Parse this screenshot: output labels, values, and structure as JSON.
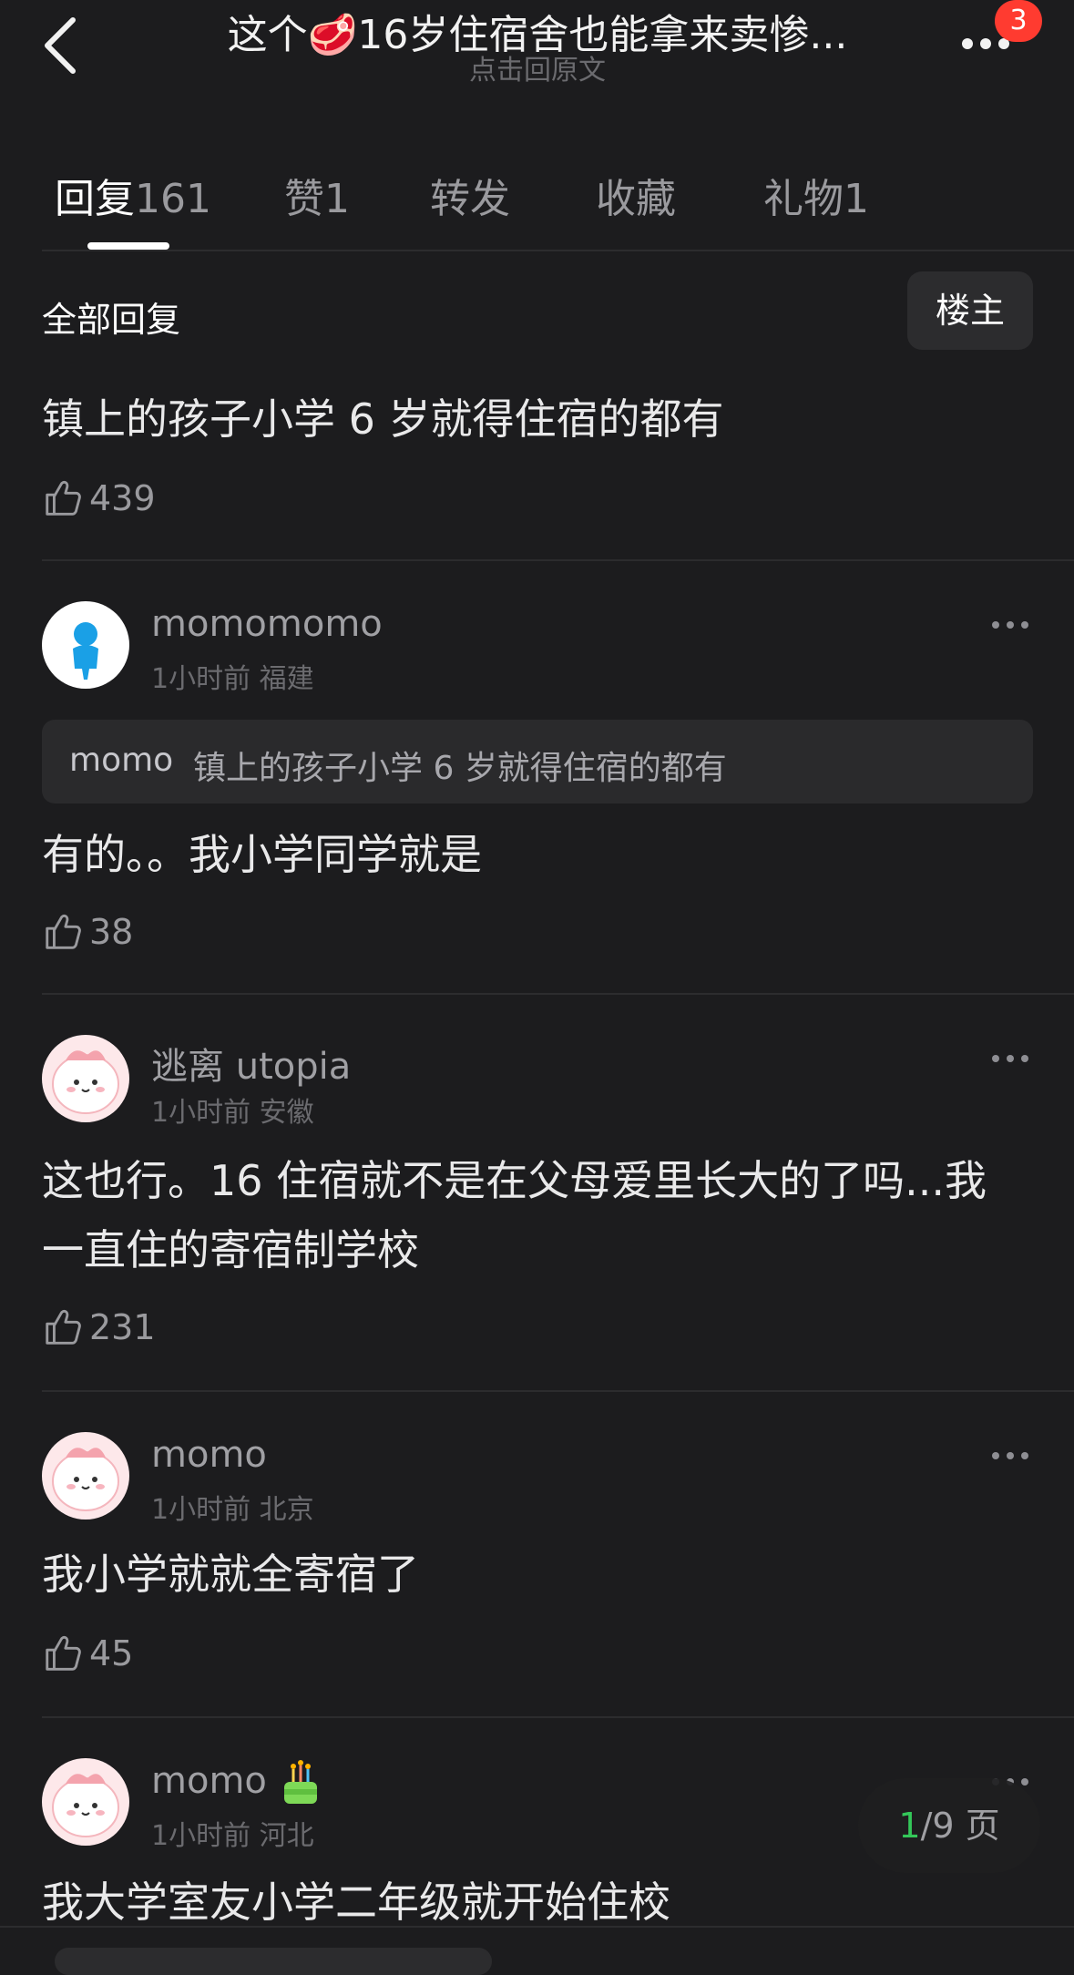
{
  "header": {
    "title": "这个🥩16岁住宿舍也能拿来卖惨...",
    "subtitle": "点击回原文",
    "badge_count": "3"
  },
  "tabs": [
    {
      "label": "回复",
      "count": "161",
      "active": true
    },
    {
      "label": "赞",
      "count": "1",
      "active": false
    },
    {
      "label": "转发",
      "count": "",
      "active": false
    },
    {
      "label": "收藏",
      "count": "",
      "active": false
    },
    {
      "label": "礼物",
      "count": "1",
      "active": false
    }
  ],
  "section": {
    "title": "全部回复",
    "owner_button": "楼主"
  },
  "op": {
    "text": "镇上的孩子小学 6 岁就得住宿的都有",
    "likes": "439"
  },
  "comments": [
    {
      "username": "momomomo",
      "time": "1小时前",
      "location": "福建",
      "quote_name": "momo",
      "quote_text": "镇上的孩子小学 6 岁就得住宿的都有",
      "text": "有的。。我小学同学就是",
      "likes": "38"
    },
    {
      "username": "逃离 utopia",
      "time": "1小时前",
      "location": "安徽",
      "text_line1": "这也行。16 住宿就不是在父母爱里长大的了吗...我",
      "text_line2": "一直住的寄宿制学校",
      "likes": "231"
    },
    {
      "username": "momo",
      "time": "1小时前",
      "location": "北京",
      "text": "我小学就就全寄宿了",
      "likes": "45"
    },
    {
      "username": "momo",
      "time": "1小时前",
      "location": "河北",
      "text": "我大学室友小学二年级就开始住校"
    }
  ],
  "pager": {
    "current": "1",
    "total_text": "/9 页"
  },
  "colors": {
    "background": "#1c1c1e",
    "badge": "#ff3b30",
    "pager_current": "#34c759",
    "avatar_blue": "#1aa0e6"
  }
}
